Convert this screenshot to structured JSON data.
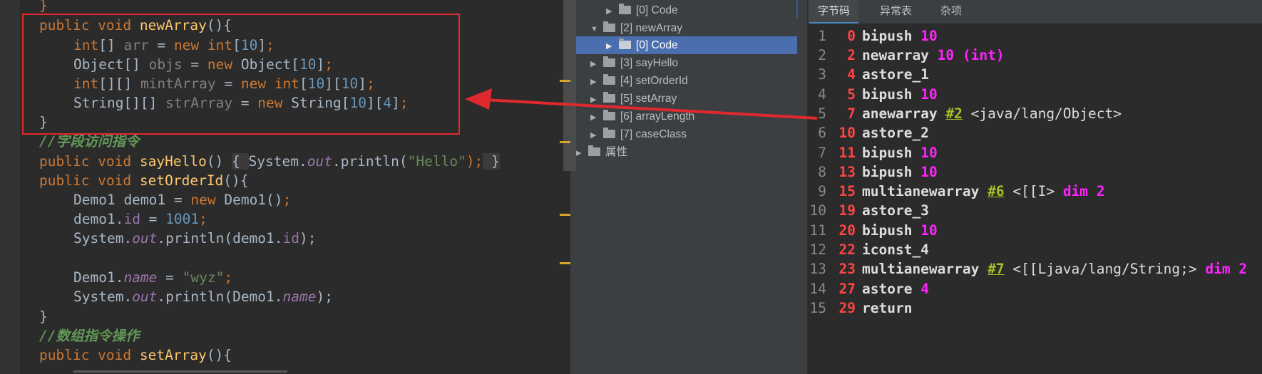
{
  "editor": {
    "lines": [
      {
        "kind": "brace",
        "text": "}"
      },
      {
        "kind": "method",
        "mod": "public void ",
        "name": "newArray",
        "rest": "(){"
      },
      {
        "kind": "decl",
        "t1": "int",
        "t2": "[] ",
        "v": "arr",
        "eq": " = ",
        "nw": "new ",
        "ty": "int",
        "b1": "[",
        "n1": "10",
        "b2": "]",
        "sc": ";"
      },
      {
        "kind": "decl2",
        "t1": "Object[] ",
        "v": "objs",
        "eq": " = ",
        "nw": "new ",
        "ty": "Object[",
        "n1": "10",
        "b2": "]",
        "sc": ";"
      },
      {
        "kind": "decl3",
        "t1": "int",
        "t2": "[][] ",
        "v": "mintArray",
        "eq": " = ",
        "nw": "new ",
        "ty": "int",
        "b1": "[",
        "n1": "10",
        "b2": "][",
        "n2": "10",
        "b3": "]",
        "sc": ";"
      },
      {
        "kind": "decl4",
        "t1": "String[][] ",
        "v": "strArray",
        "eq": " = ",
        "nw": "new ",
        "ty": "String[",
        "n1": "10",
        "b2": "][",
        "n2": "4",
        "b3": "]",
        "sc": ";"
      },
      {
        "kind": "brace",
        "text": "}"
      },
      {
        "kind": "comment",
        "text": "//字段访问指令"
      },
      {
        "kind": "sayhello",
        "mod": "public void ",
        "name": "sayHello",
        "a": "() ",
        "f1": "{ ",
        "b": "System.",
        "out": "out",
        "c": ".println(",
        "s": "\"Hello\"",
        "d": ");",
        "f2": " }"
      },
      {
        "kind": "method",
        "mod": "public void ",
        "name": "setOrderId",
        "rest": "(){"
      },
      {
        "kind": "newobj",
        "a": "Demo1 demo1 = ",
        "nw": "new ",
        "b": "Demo1()",
        "sc": ";"
      },
      {
        "kind": "assign",
        "a": "demo1.",
        "f": "id",
        "b": " = ",
        "n": "1001",
        "sc": ";"
      },
      {
        "kind": "print",
        "a": "System.",
        "out": "out",
        "b": ".println(demo1.",
        "f": "id",
        "c": ");"
      },
      {
        "kind": "blank"
      },
      {
        "kind": "assignstr",
        "a": "Demo1.",
        "f": "name",
        "b": " = ",
        "s": "\"wyz\"",
        "sc": ";"
      },
      {
        "kind": "print2",
        "a": "System.",
        "out": "out",
        "b": ".println(Demo1.",
        "f": "name",
        "c": ");"
      },
      {
        "kind": "brace",
        "text": "}"
      },
      {
        "kind": "comment",
        "text": "//数组指令操作"
      },
      {
        "kind": "method",
        "mod": "public void ",
        "name": "setArray",
        "rest": "(){"
      }
    ]
  },
  "tree": {
    "items": [
      {
        "arrow": "▶",
        "label": "[0] Code"
      },
      {
        "arrow": "▼",
        "label": "[2] newArray"
      },
      {
        "arrow": "▶",
        "label": "[0] Code",
        "selected": true
      },
      {
        "arrow": "▶",
        "label": "[3] sayHello"
      },
      {
        "arrow": "▶",
        "label": "[4] setOrderId"
      },
      {
        "arrow": "▶",
        "label": "[5] setArray"
      },
      {
        "arrow": "▶",
        "label": "[6] arrayLength"
      },
      {
        "arrow": "▶",
        "label": "[7] caseClass"
      },
      {
        "arrow": "▶",
        "label": "属性"
      }
    ]
  },
  "tabs": [
    "字节码",
    "异常表",
    "杂项"
  ],
  "bytecode": [
    {
      "ln": "1",
      "off": "0",
      "op": "bipush",
      "a": "10"
    },
    {
      "ln": "2",
      "off": "2",
      "op": "newarray",
      "a": "10 (int)"
    },
    {
      "ln": "3",
      "off": "4",
      "op": "astore_1"
    },
    {
      "ln": "4",
      "off": "5",
      "op": "bipush",
      "a": "10"
    },
    {
      "ln": "5",
      "off": "7",
      "op": "anewarray",
      "ref": "#2",
      "cls": "<java/lang/Object>"
    },
    {
      "ln": "6",
      "off": "10",
      "op": "astore_2"
    },
    {
      "ln": "7",
      "off": "11",
      "op": "bipush",
      "a": "10"
    },
    {
      "ln": "8",
      "off": "13",
      "op": "bipush",
      "a": "10"
    },
    {
      "ln": "9",
      "off": "15",
      "op": "multianewarray",
      "ref": "#6",
      "cls": "<[[I>",
      "dim": "dim 2"
    },
    {
      "ln": "10",
      "off": "19",
      "op": "astore_3"
    },
    {
      "ln": "11",
      "off": "20",
      "op": "bipush",
      "a": "10"
    },
    {
      "ln": "12",
      "off": "22",
      "op": "iconst_4"
    },
    {
      "ln": "13",
      "off": "23",
      "op": "multianewarray",
      "ref": "#7",
      "cls": "<[[Ljava/lang/String;>",
      "dim": "dim 2"
    },
    {
      "ln": "14",
      "off": "27",
      "op": "astore",
      "a": "4"
    },
    {
      "ln": "15",
      "off": "29",
      "op": "return"
    }
  ],
  "colors": {
    "highlight_box": "#e0292e",
    "selection": "#4b6eaf",
    "offset": "#ff4444",
    "operand": "#ff22ff"
  }
}
